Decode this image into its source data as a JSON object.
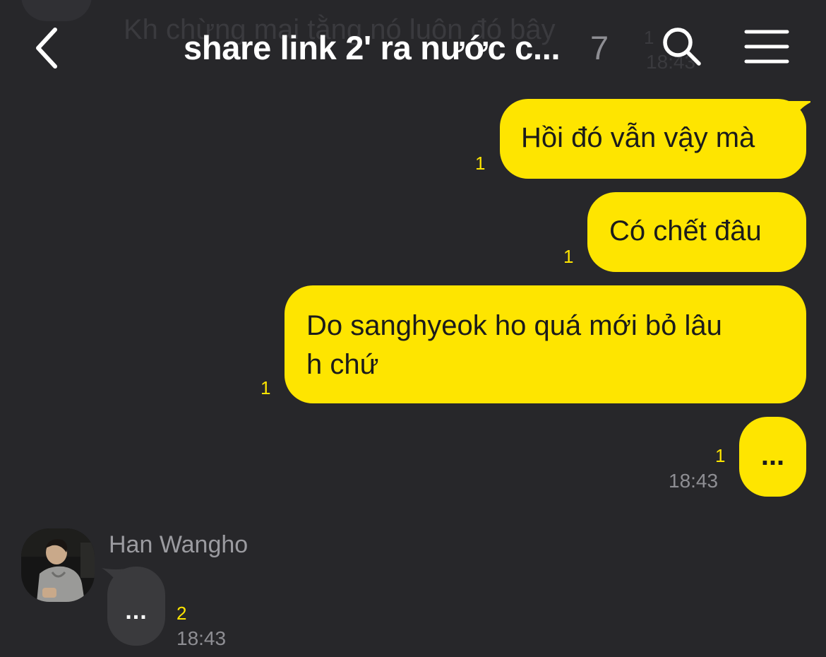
{
  "header": {
    "title": "share link 2' ra nước c...",
    "member_count": "7",
    "back_icon": "chevron-left-icon",
    "search_icon": "search-icon",
    "menu_icon": "hamburger-menu-icon"
  },
  "ghost": {
    "text": "Kh chừng mai tằng nó luôn đó bây",
    "count": "1",
    "time": "18:43"
  },
  "messages": [
    {
      "text": "Hồi đó vẫn vậy mà",
      "unread": "1"
    },
    {
      "text": "Có chết đâu",
      "unread": "1"
    },
    {
      "text": "Do sanghyeok ho quá mới bỏ lâu\nh chứ",
      "unread": "1"
    },
    {
      "text": "...",
      "unread": "1",
      "time": "18:43"
    }
  ],
  "incoming": {
    "sender": "Han Wangho",
    "text": "...",
    "unread": "2",
    "time": "18:43"
  },
  "colors": {
    "background": "#27272a",
    "my_bubble": "#fee500",
    "their_bubble": "#3a3a3d",
    "unread_count": "#fee500",
    "muted_text": "#8e8e93"
  }
}
